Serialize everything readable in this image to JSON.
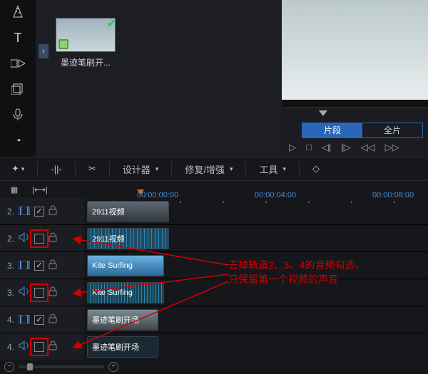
{
  "media": {
    "thumb_label": "墨迹笔刷开..."
  },
  "preview": {
    "tab_segment": "片段",
    "tab_full": "全片"
  },
  "toolbar": {
    "designer": "设计器",
    "fix_enhance": "修复/增强",
    "tools": "工具"
  },
  "ruler": {
    "t0": "00:00:00:00",
    "t4": "00:00:04:00",
    "t8": "00:00:08:00"
  },
  "tracks": [
    {
      "idx": "2.",
      "type": "video",
      "checked": true,
      "red": false,
      "clip_label": "2911视频",
      "clip_class": "video"
    },
    {
      "idx": "2.",
      "type": "audio",
      "checked": false,
      "red": true,
      "clip_label": "2911视频",
      "clip_class": "audio"
    },
    {
      "idx": "3.",
      "type": "video",
      "checked": true,
      "red": false,
      "clip_label": "Kite Surfing",
      "clip_class": "kite-v"
    },
    {
      "idx": "3.",
      "type": "audio",
      "checked": false,
      "red": true,
      "clip_label": "Kite Surfing",
      "clip_class": "kite-a"
    },
    {
      "idx": "4.",
      "type": "video",
      "checked": true,
      "red": false,
      "clip_label": "墨迹笔刷开场",
      "clip_class": "ink-v"
    },
    {
      "idx": "4.",
      "type": "audio",
      "checked": false,
      "red": true,
      "clip_label": "墨迹笔刷开场",
      "clip_class": "ink-a"
    }
  ],
  "annotation": {
    "line1": "去掉轨道2、3、4的音频勾选，",
    "line2": "只保留第一个视频的声音"
  }
}
